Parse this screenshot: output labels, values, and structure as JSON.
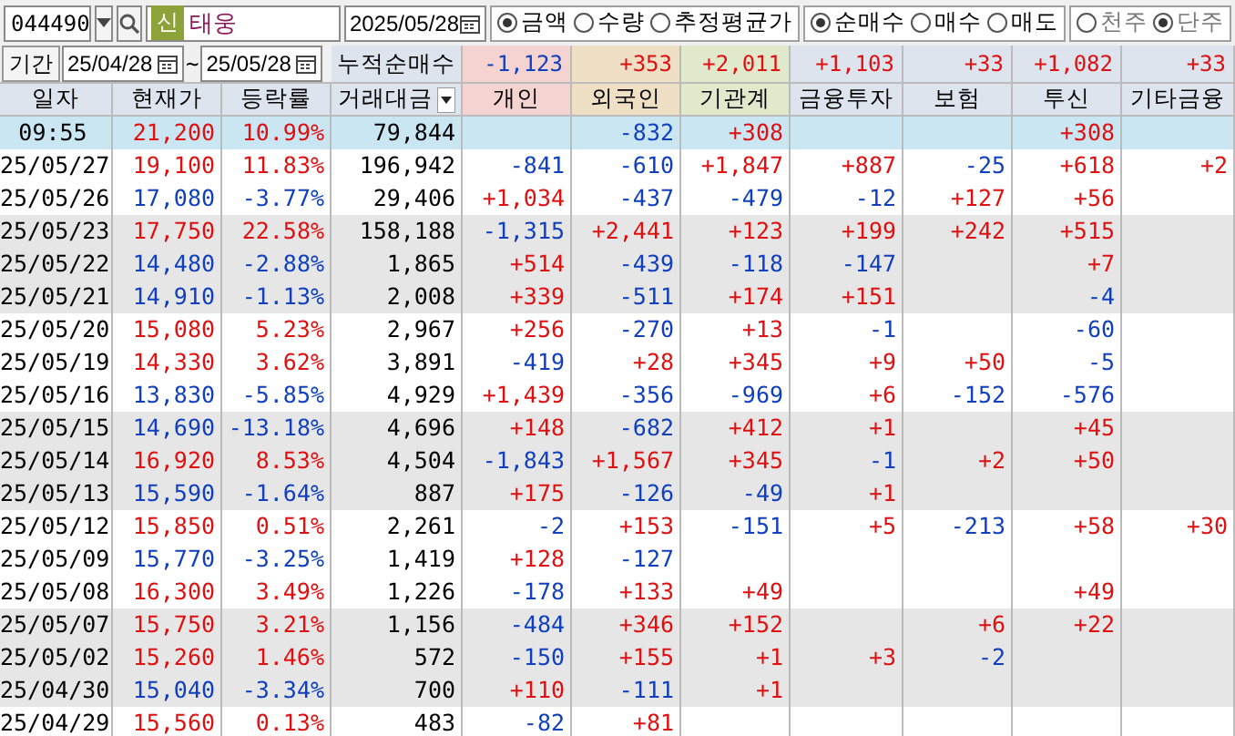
{
  "toolbar": {
    "code": "044490",
    "badge": "신",
    "name": "태웅",
    "date": "2025/05/28",
    "radio_groups": [
      [
        {
          "label": "금액",
          "selected": true
        },
        {
          "label": "수량",
          "selected": false
        },
        {
          "label": "추정평균가",
          "selected": false
        }
      ],
      [
        {
          "label": "순매수",
          "selected": true
        },
        {
          "label": "매수",
          "selected": false
        },
        {
          "label": "매도",
          "selected": false
        }
      ],
      [
        {
          "label": "천주",
          "selected": false
        },
        {
          "label": "단주",
          "selected": true
        }
      ]
    ]
  },
  "period": {
    "label": "기간",
    "from": "25/04/28",
    "separator": "~",
    "to": "25/05/28",
    "summary_label": "누적순매수",
    "summary": [
      {
        "v": "-1,123",
        "up": false
      },
      {
        "v": "+353",
        "up": true
      },
      {
        "v": "+2,011",
        "up": true
      },
      {
        "v": "+1,103",
        "up": true
      },
      {
        "v": "+33",
        "up": true
      },
      {
        "v": "+1,082",
        "up": true
      },
      {
        "v": "+33",
        "up": true
      }
    ]
  },
  "table": {
    "columns": [
      {
        "label": "일자",
        "kind": "plain"
      },
      {
        "label": "현재가",
        "kind": "plain"
      },
      {
        "label": "등락률",
        "kind": "plain"
      },
      {
        "label": "거래대금",
        "kind": "sort"
      },
      {
        "label": "개인",
        "kind": "individual"
      },
      {
        "label": "외국인",
        "kind": "foreign"
      },
      {
        "label": "기관계",
        "kind": "institution"
      },
      {
        "label": "금융투자",
        "kind": "detail"
      },
      {
        "label": "보험",
        "kind": "detail"
      },
      {
        "label": "투신",
        "kind": "detail"
      },
      {
        "label": "기타금융",
        "kind": "detail"
      }
    ],
    "rows": [
      {
        "date": "09:55",
        "price": "21,200",
        "rate": "10.99%",
        "amount": "79,844",
        "up": true,
        "current": true,
        "shaded": false,
        "flows": {
          "foreign": {
            "v": "-832",
            "up": false
          },
          "institution": {
            "v": "+308",
            "up": true
          },
          "trust": {
            "v": "+308",
            "up": true
          }
        }
      },
      {
        "date": "25/05/27",
        "price": "19,100",
        "rate": "11.83%",
        "amount": "196,942",
        "up": true,
        "current": false,
        "shaded": false,
        "flows": {
          "individual": {
            "v": "-841",
            "up": false
          },
          "foreign": {
            "v": "-610",
            "up": false
          },
          "institution": {
            "v": "+1,847",
            "up": true
          },
          "financial_investment": {
            "v": "+887",
            "up": true
          },
          "insurance": {
            "v": "-25",
            "up": false
          },
          "trust": {
            "v": "+618",
            "up": true
          },
          "other_finance": {
            "v": "+2",
            "up": true
          }
        }
      },
      {
        "date": "25/05/26",
        "price": "17,080",
        "rate": "-3.77%",
        "amount": "29,406",
        "up": false,
        "current": false,
        "shaded": false,
        "flows": {
          "individual": {
            "v": "+1,034",
            "up": true
          },
          "foreign": {
            "v": "-437",
            "up": false
          },
          "institution": {
            "v": "-479",
            "up": false
          },
          "financial_investment": {
            "v": "-12",
            "up": false
          },
          "insurance": {
            "v": "+127",
            "up": true
          },
          "trust": {
            "v": "+56",
            "up": true
          }
        }
      },
      {
        "date": "25/05/23",
        "price": "17,750",
        "rate": "22.58%",
        "amount": "158,188",
        "up": true,
        "current": false,
        "shaded": true,
        "flows": {
          "individual": {
            "v": "-1,315",
            "up": false
          },
          "foreign": {
            "v": "+2,441",
            "up": true
          },
          "institution": {
            "v": "+123",
            "up": true
          },
          "financial_investment": {
            "v": "+199",
            "up": true
          },
          "insurance": {
            "v": "+242",
            "up": true
          },
          "trust": {
            "v": "+515",
            "up": true
          }
        }
      },
      {
        "date": "25/05/22",
        "price": "14,480",
        "rate": "-2.88%",
        "amount": "1,865",
        "up": false,
        "current": false,
        "shaded": true,
        "flows": {
          "individual": {
            "v": "+514",
            "up": true
          },
          "foreign": {
            "v": "-439",
            "up": false
          },
          "institution": {
            "v": "-118",
            "up": false
          },
          "financial_investment": {
            "v": "-147",
            "up": false
          },
          "trust": {
            "v": "+7",
            "up": true
          }
        }
      },
      {
        "date": "25/05/21",
        "price": "14,910",
        "rate": "-1.13%",
        "amount": "2,008",
        "up": false,
        "current": false,
        "shaded": true,
        "flows": {
          "individual": {
            "v": "+339",
            "up": true
          },
          "foreign": {
            "v": "-511",
            "up": false
          },
          "institution": {
            "v": "+174",
            "up": true
          },
          "financial_investment": {
            "v": "+151",
            "up": true
          },
          "trust": {
            "v": "-4",
            "up": false
          }
        }
      },
      {
        "date": "25/05/20",
        "price": "15,080",
        "rate": "5.23%",
        "amount": "2,967",
        "up": true,
        "current": false,
        "shaded": false,
        "flows": {
          "individual": {
            "v": "+256",
            "up": true
          },
          "foreign": {
            "v": "-270",
            "up": false
          },
          "institution": {
            "v": "+13",
            "up": true
          },
          "financial_investment": {
            "v": "-1",
            "up": false
          },
          "trust": {
            "v": "-60",
            "up": false
          }
        }
      },
      {
        "date": "25/05/19",
        "price": "14,330",
        "rate": "3.62%",
        "amount": "3,891",
        "up": true,
        "current": false,
        "shaded": false,
        "flows": {
          "individual": {
            "v": "-419",
            "up": false
          },
          "foreign": {
            "v": "+28",
            "up": true
          },
          "institution": {
            "v": "+345",
            "up": true
          },
          "financial_investment": {
            "v": "+9",
            "up": true
          },
          "insurance": {
            "v": "+50",
            "up": true
          },
          "trust": {
            "v": "-5",
            "up": false
          }
        }
      },
      {
        "date": "25/05/16",
        "price": "13,830",
        "rate": "-5.85%",
        "amount": "4,929",
        "up": false,
        "current": false,
        "shaded": false,
        "flows": {
          "individual": {
            "v": "+1,439",
            "up": true
          },
          "foreign": {
            "v": "-356",
            "up": false
          },
          "institution": {
            "v": "-969",
            "up": false
          },
          "financial_investment": {
            "v": "+6",
            "up": true
          },
          "insurance": {
            "v": "-152",
            "up": false
          },
          "trust": {
            "v": "-576",
            "up": false
          }
        }
      },
      {
        "date": "25/05/15",
        "price": "14,690",
        "rate": "-13.18%",
        "amount": "4,696",
        "up": false,
        "current": false,
        "shaded": true,
        "flows": {
          "individual": {
            "v": "+148",
            "up": true
          },
          "foreign": {
            "v": "-682",
            "up": false
          },
          "institution": {
            "v": "+412",
            "up": true
          },
          "financial_investment": {
            "v": "+1",
            "up": true
          },
          "trust": {
            "v": "+45",
            "up": true
          }
        }
      },
      {
        "date": "25/05/14",
        "price": "16,920",
        "rate": "8.53%",
        "amount": "4,504",
        "up": true,
        "current": false,
        "shaded": true,
        "flows": {
          "individual": {
            "v": "-1,843",
            "up": false
          },
          "foreign": {
            "v": "+1,567",
            "up": true
          },
          "institution": {
            "v": "+345",
            "up": true
          },
          "financial_investment": {
            "v": "-1",
            "up": false
          },
          "insurance": {
            "v": "+2",
            "up": true
          },
          "trust": {
            "v": "+50",
            "up": true
          }
        }
      },
      {
        "date": "25/05/13",
        "price": "15,590",
        "rate": "-1.64%",
        "amount": "887",
        "up": false,
        "current": false,
        "shaded": true,
        "flows": {
          "individual": {
            "v": "+175",
            "up": true
          },
          "foreign": {
            "v": "-126",
            "up": false
          },
          "institution": {
            "v": "-49",
            "up": false
          },
          "financial_investment": {
            "v": "+1",
            "up": true
          }
        }
      },
      {
        "date": "25/05/12",
        "price": "15,850",
        "rate": "0.51%",
        "amount": "2,261",
        "up": true,
        "current": false,
        "shaded": false,
        "flows": {
          "individual": {
            "v": "-2",
            "up": false
          },
          "foreign": {
            "v": "+153",
            "up": true
          },
          "institution": {
            "v": "-151",
            "up": false
          },
          "financial_investment": {
            "v": "+5",
            "up": true
          },
          "insurance": {
            "v": "-213",
            "up": false
          },
          "trust": {
            "v": "+58",
            "up": true
          },
          "other_finance": {
            "v": "+30",
            "up": true
          }
        }
      },
      {
        "date": "25/05/09",
        "price": "15,770",
        "rate": "-3.25%",
        "amount": "1,419",
        "up": false,
        "current": false,
        "shaded": false,
        "flows": {
          "individual": {
            "v": "+128",
            "up": true
          },
          "foreign": {
            "v": "-127",
            "up": false
          }
        }
      },
      {
        "date": "25/05/08",
        "price": "16,300",
        "rate": "3.49%",
        "amount": "1,226",
        "up": true,
        "current": false,
        "shaded": false,
        "flows": {
          "individual": {
            "v": "-178",
            "up": false
          },
          "foreign": {
            "v": "+133",
            "up": true
          },
          "institution": {
            "v": "+49",
            "up": true
          },
          "trust": {
            "v": "+49",
            "up": true
          }
        }
      },
      {
        "date": "25/05/07",
        "price": "15,750",
        "rate": "3.21%",
        "amount": "1,156",
        "up": true,
        "current": false,
        "shaded": true,
        "flows": {
          "individual": {
            "v": "-484",
            "up": false
          },
          "foreign": {
            "v": "+346",
            "up": true
          },
          "institution": {
            "v": "+152",
            "up": true
          },
          "insurance": {
            "v": "+6",
            "up": true
          },
          "trust": {
            "v": "+22",
            "up": true
          }
        }
      },
      {
        "date": "25/05/02",
        "price": "15,260",
        "rate": "1.46%",
        "amount": "572",
        "up": true,
        "current": false,
        "shaded": true,
        "flows": {
          "individual": {
            "v": "-150",
            "up": false
          },
          "foreign": {
            "v": "+155",
            "up": true
          },
          "institution": {
            "v": "+1",
            "up": true
          },
          "financial_investment": {
            "v": "+3",
            "up": true
          },
          "insurance": {
            "v": "-2",
            "up": false
          }
        }
      },
      {
        "date": "25/04/30",
        "price": "15,040",
        "rate": "-3.34%",
        "amount": "700",
        "up": false,
        "current": false,
        "shaded": true,
        "flows": {
          "individual": {
            "v": "+110",
            "up": true
          },
          "foreign": {
            "v": "-111",
            "up": false
          },
          "institution": {
            "v": "+1",
            "up": true
          }
        }
      },
      {
        "date": "25/04/29",
        "price": "15,560",
        "rate": "0.13%",
        "amount": "483",
        "up": true,
        "current": false,
        "shaded": false,
        "flows": {
          "individual": {
            "v": "-82",
            "up": false
          },
          "foreign": {
            "v": "+81",
            "up": true
          }
        }
      }
    ]
  }
}
